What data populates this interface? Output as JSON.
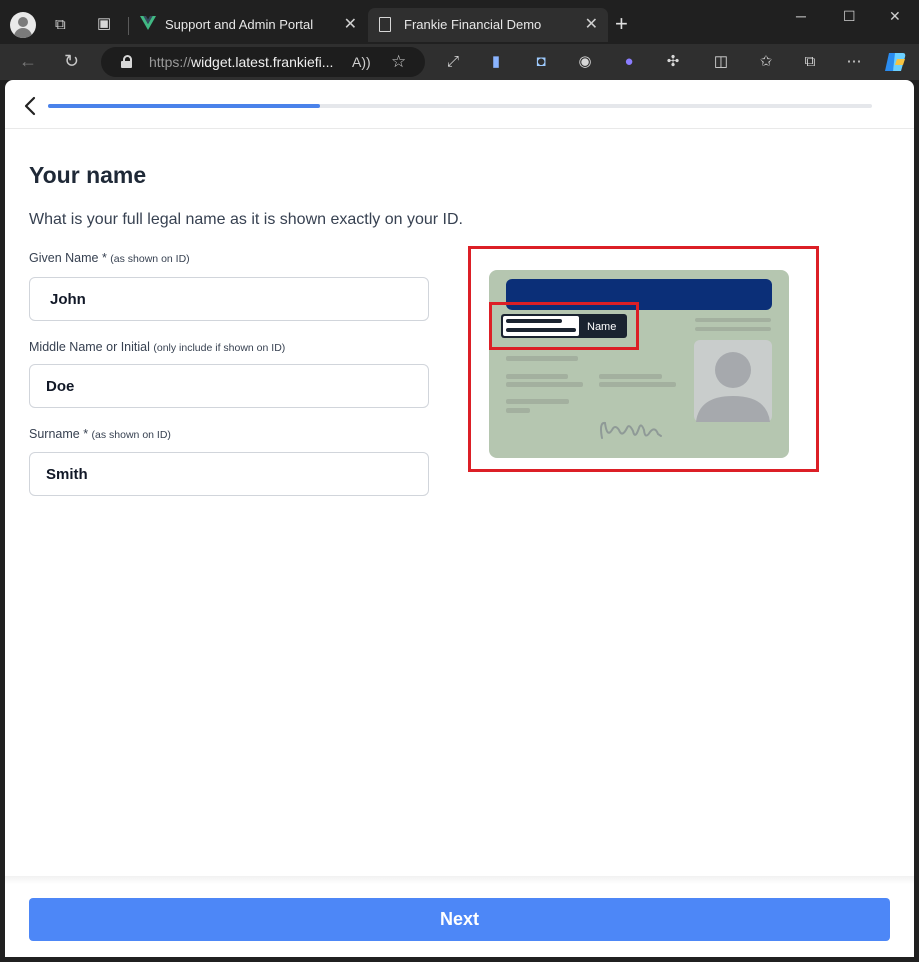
{
  "browser": {
    "tabs": [
      {
        "title": "Support and Admin Portal",
        "icon": "vue-logo-icon",
        "active": false
      },
      {
        "title": "Frankie Financial Demo",
        "icon": "page-icon",
        "active": true
      }
    ],
    "url_prefix": "https://",
    "url_host": "widget.latest.frankiefi..."
  },
  "form": {
    "progress_percent": 33,
    "title": "Your name",
    "subtitle": "What is your full legal name as it is shown exactly on your ID.",
    "fields": [
      {
        "label": "Given Name *",
        "hint": "(as shown on ID)",
        "value": "John"
      },
      {
        "label": "Middle Name or Initial",
        "hint": "(only include if shown on ID)",
        "value": "Doe"
      },
      {
        "label": "Surname *",
        "hint": "(as shown on ID)",
        "value": "Smith"
      }
    ],
    "id_card_name_label": "Name",
    "next_label": "Next"
  },
  "colors": {
    "accent": "#4d87f7",
    "highlight": "#dc1f26",
    "card": "#b5c6b0",
    "card_header": "#0b2f78"
  }
}
